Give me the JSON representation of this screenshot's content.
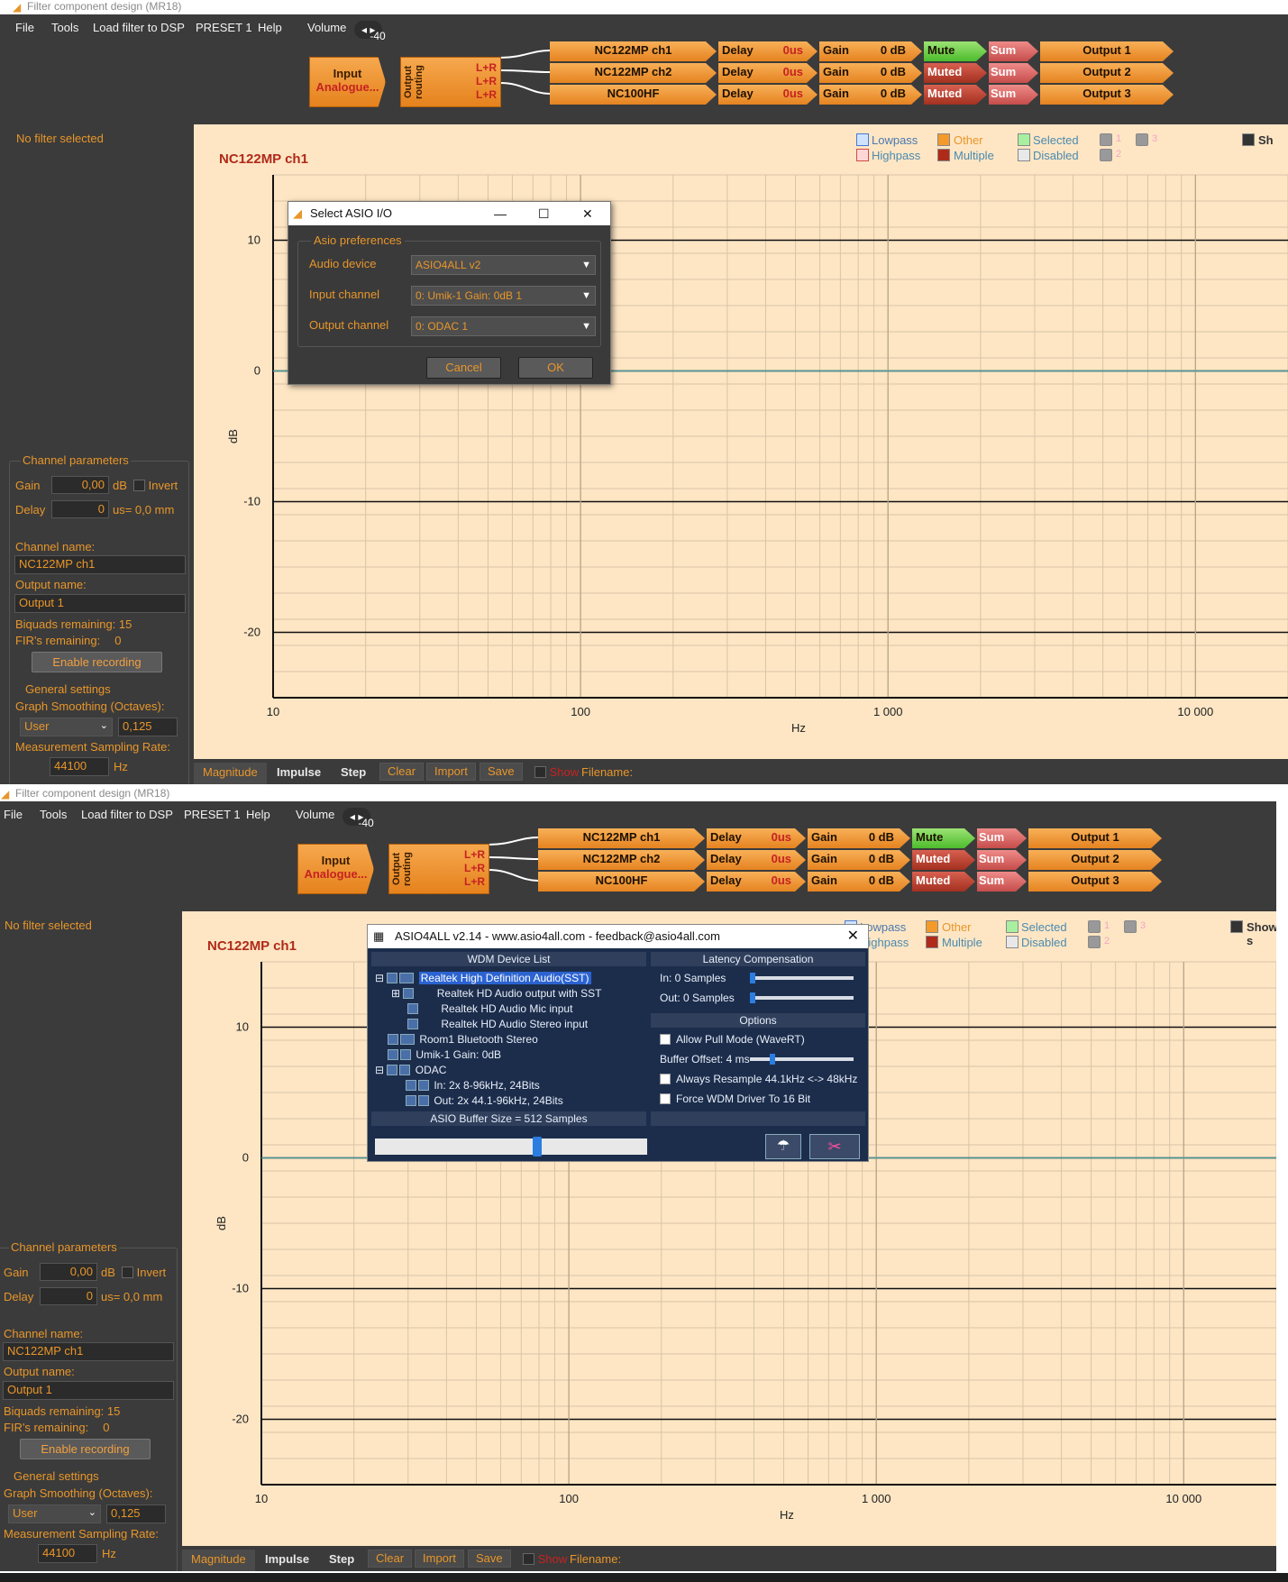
{
  "window": {
    "title": "Filter component design (MR18)"
  },
  "menu": {
    "file": "File",
    "tools": "Tools",
    "load": "Load filter to DSP",
    "preset": "PRESET 1",
    "help": "Help",
    "volume_label": "Volume",
    "volume_value": "-40"
  },
  "pipeline": {
    "input_label": "Input",
    "input_source": "Analogue...",
    "routing_label": "Output routing",
    "routing_rows": [
      "L+R",
      "L+R",
      "L+R"
    ],
    "channels": [
      {
        "name": "NC122MP ch1",
        "delay_label": "Delay",
        "delay_value": "0us",
        "gain_label": "Gain",
        "gain_value": "0 dB",
        "mute": "Mute",
        "sum": "Sum",
        "output": "Output 1"
      },
      {
        "name": "NC122MP ch2",
        "delay_label": "Delay",
        "delay_value": "0us",
        "gain_label": "Gain",
        "gain_value": "0 dB",
        "mute": "Muted",
        "sum": "Sum",
        "output": "Output 2"
      },
      {
        "name": "NC100HF",
        "delay_label": "Delay",
        "delay_value": "0us",
        "gain_label": "Gain",
        "gain_value": "0 dB",
        "mute": "Muted",
        "sum": "Sum",
        "output": "Output 3"
      }
    ]
  },
  "sidebar": {
    "no_filter": "No filter selected",
    "channel_params": "Channel parameters",
    "gain_label": "Gain",
    "gain_value": "0,00",
    "gain_unit": "dB",
    "invert": "Invert",
    "delay_label": "Delay",
    "delay_value": "0",
    "delay_unit": "us= 0,0 mm",
    "channel_name_label": "Channel name:",
    "channel_name": "NC122MP ch1",
    "output_name_label": "Output name:",
    "output_name": "Output 1",
    "biquads": "Biquads remaining: 15",
    "firs": "FIR's remaining:",
    "firs_value": "0",
    "enable_recording": "Enable recording",
    "general_settings": "General settings",
    "smoothing_label": "Graph Smoothing (Octaves):",
    "smoothing_mode": "User",
    "smoothing_value": "0,125",
    "sampling_label": "Measurement Sampling Rate:",
    "sampling_value": "44100",
    "sampling_unit": "Hz"
  },
  "legend": {
    "lowpass": "Lowpass",
    "highpass": "Highpass",
    "other": "Other",
    "multiple": "Multiple",
    "selected": "Selected",
    "disabled": "Disabled",
    "n1": "1",
    "n2": "2",
    "n3": "3",
    "show1": "Sh",
    "show2": "Show s"
  },
  "chart_data": {
    "type": "line",
    "title": "NC122MP ch1",
    "xlabel": "Hz",
    "ylabel": "dB",
    "x_scale": "log",
    "xlim": [
      10,
      20000
    ],
    "ylim": [
      -25,
      15
    ],
    "x_ticks": [
      "10",
      "100",
      "1 000",
      "10 000"
    ],
    "y_ticks": [
      "10",
      "0",
      "-10",
      "-20"
    ],
    "grid": true,
    "series": [
      {
        "x": [
          10,
          20000
        ],
        "y": [
          0,
          0
        ],
        "color": "#4a9c9c"
      }
    ]
  },
  "bottom": {
    "magnitude": "Magnitude",
    "impulse": "Impulse",
    "step": "Step",
    "clear": "Clear",
    "import": "Import",
    "save": "Save",
    "show": "Show",
    "filename": "Filename:"
  },
  "asio_dialog": {
    "title": "Select ASIO I/O",
    "group": "Asio preferences",
    "audio_device_label": "Audio device",
    "audio_device": "ASIO4ALL v2",
    "input_label": "Input channel",
    "input": "0: Umik-1  Gain: 0dB  1",
    "output_label": "Output channel",
    "output": "0: ODAC  1",
    "cancel": "Cancel",
    "ok": "OK"
  },
  "asio4all": {
    "title": "ASIO4ALL v2.14 - www.asio4all.com - feedback@asio4all.com",
    "wdm_header": "WDM Device List",
    "latency_header": "Latency Compensation",
    "in_label": "In:  0 Samples",
    "out_label": "Out: 0 Samples",
    "options_header": "Options",
    "opt_pull": "Allow Pull Mode (WaveRT)",
    "buffer_offset": "Buffer Offset: 4 ms",
    "opt_resample": "Always Resample 44.1kHz <-> 48kHz",
    "opt_force16": "Force WDM Driver To 16 Bit",
    "buffer_size": "ASIO Buffer Size = 512 Samples",
    "tree": [
      "Realtek High Definition Audio(SST)",
      "Realtek HD Audio output with SST",
      "Realtek HD Audio Mic input",
      "Realtek HD Audio Stereo input",
      "Room1 Bluetooth Stereo",
      "Umik-1  Gain: 0dB",
      "ODAC",
      "In:   2x 8-96kHz, 24Bits",
      "Out: 2x 44.1-96kHz, 24Bits"
    ]
  }
}
